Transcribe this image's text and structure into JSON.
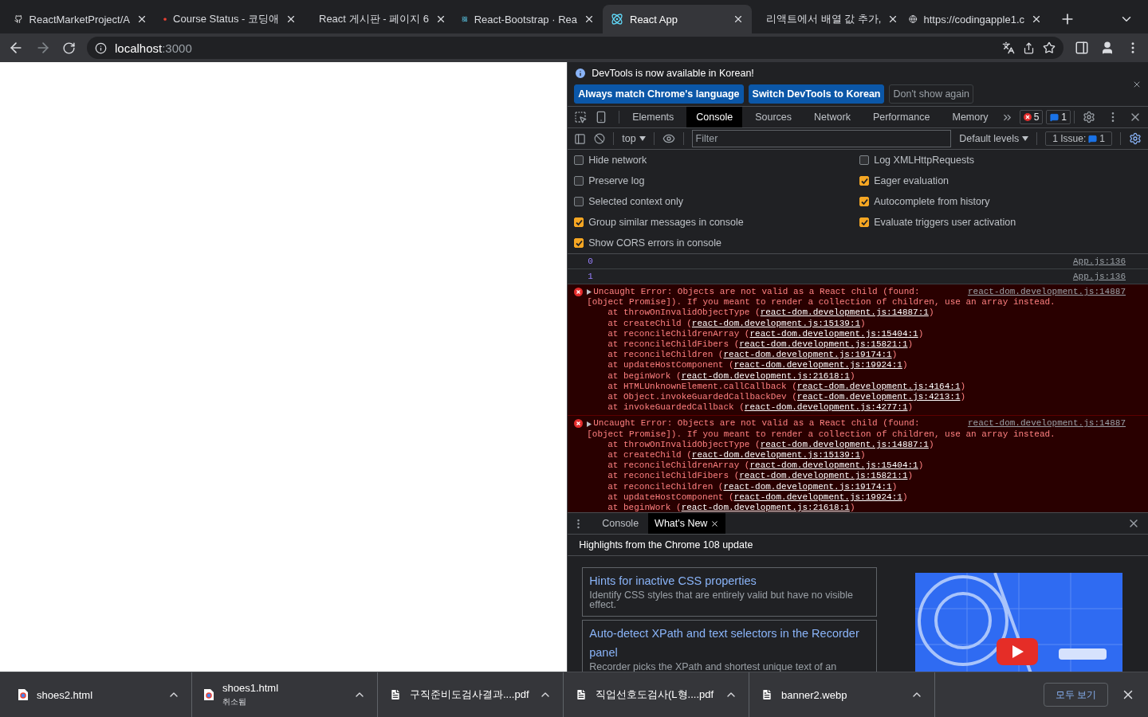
{
  "browser_tabs": [
    {
      "title": "ReactMarketProject/A",
      "kind": "logo",
      "selected": false
    },
    {
      "title": "Course Status - 코딩애",
      "kind": "apple",
      "selected": false
    },
    {
      "title": "React 게시판 - 페이지 6",
      "kind": "apple",
      "selected": false
    },
    {
      "title": "React-Bootstrap · Rea",
      "kind": "atom",
      "selected": false
    },
    {
      "title": "React App",
      "kind": "atom",
      "selected": true
    },
    {
      "title": "리액트에서 배열 값 추가,",
      "kind": "logo",
      "selected": false
    },
    {
      "title": "https://codingapple1.c",
      "kind": "globe",
      "selected": false
    }
  ],
  "address_bar": {
    "host": "localhost",
    "port": ":3000"
  },
  "infobar": {
    "message": "DevTools is now available in Korean!",
    "buttons": [
      {
        "label": "Always match Chrome's language",
        "kind": "primary"
      },
      {
        "label": "Switch DevTools to Korean",
        "kind": "primary"
      },
      {
        "label": "Don't show again",
        "kind": "secondary"
      }
    ]
  },
  "devtools_tabs": [
    {
      "label": "Elements",
      "selected": false
    },
    {
      "label": "Console",
      "selected": true
    },
    {
      "label": "Sources",
      "selected": false
    },
    {
      "label": "Network",
      "selected": false
    },
    {
      "label": "Performance",
      "selected": false
    },
    {
      "label": "Memory",
      "selected": false
    }
  ],
  "counters": {
    "errors": "5",
    "messages": "1"
  },
  "console_toolbar": {
    "context": "top",
    "filter_placeholder": "Filter",
    "levels": "Default levels",
    "issues_label": "1 Issue:",
    "issues_count": "1"
  },
  "settings": [
    {
      "label": "Hide network",
      "checked": false
    },
    {
      "label": "Log XMLHttpRequests",
      "checked": false
    },
    {
      "label": "Preserve log",
      "checked": false
    },
    {
      "label": "Eager evaluation",
      "checked": true
    },
    {
      "label": "Selected context only",
      "checked": false
    },
    {
      "label": "Autocomplete from history",
      "checked": true
    },
    {
      "label": "Group similar messages in console",
      "checked": true
    },
    {
      "label": "Evaluate triggers user activation",
      "checked": true
    },
    {
      "label": "Show CORS errors in console",
      "checked": true
    }
  ],
  "messages": [
    {
      "kind": "log",
      "text": "0",
      "source": "App.js:136"
    },
    {
      "kind": "log",
      "text": "1",
      "source": "App.js:136"
    },
    {
      "kind": "error",
      "lines": [
        "Uncaught Error: Objects are not valid as a React child (found:",
        "[object Promise]). If you meant to render a collection of children, use an array instead."
      ],
      "source": "react-dom.development.js:14887",
      "stack": [
        {
          "fn": "at throwOnInvalidObjectType (",
          "link": "react-dom.development.js:14887:1"
        },
        {
          "fn": "at createChild (",
          "link": "react-dom.development.js:15139:1"
        },
        {
          "fn": "at reconcileChildrenArray (",
          "link": "react-dom.development.js:15404:1"
        },
        {
          "fn": "at reconcileChildFibers (",
          "link": "react-dom.development.js:15821:1"
        },
        {
          "fn": "at reconcileChildren (",
          "link": "react-dom.development.js:19174:1"
        },
        {
          "fn": "at updateHostComponent (",
          "link": "react-dom.development.js:19924:1"
        },
        {
          "fn": "at beginWork (",
          "link": "react-dom.development.js:21618:1"
        },
        {
          "fn": "at HTMLUnknownElement.callCallback (",
          "link": "react-dom.development.js:4164:1"
        },
        {
          "fn": "at Object.invokeGuardedCallbackDev (",
          "link": "react-dom.development.js:4213:1"
        },
        {
          "fn": "at invokeGuardedCallback (",
          "link": "react-dom.development.js:4277:1"
        }
      ]
    },
    {
      "kind": "error",
      "lines": [
        "Uncaught Error: Objects are not valid as a React child (found:",
        "[object Promise]). If you meant to render a collection of children, use an array instead."
      ],
      "source": "react-dom.development.js:14887",
      "stack": [
        {
          "fn": "at throwOnInvalidObjectType (",
          "link": "react-dom.development.js:14887:1"
        },
        {
          "fn": "at createChild (",
          "link": "react-dom.development.js:15139:1"
        },
        {
          "fn": "at reconcileChildrenArray (",
          "link": "react-dom.development.js:15404:1"
        },
        {
          "fn": "at reconcileChildFibers (",
          "link": "react-dom.development.js:15821:1"
        },
        {
          "fn": "at reconcileChildren (",
          "link": "react-dom.development.js:19174:1"
        },
        {
          "fn": "at updateHostComponent (",
          "link": "react-dom.development.js:19924:1"
        },
        {
          "fn": "at beginWork (",
          "link": "react-dom.development.js:21618:1"
        }
      ]
    }
  ],
  "stack_close": ")",
  "drawer_tabs": [
    {
      "label": "Console",
      "selected": false,
      "closable": false
    },
    {
      "label": "What's New",
      "selected": true,
      "closable": true
    }
  ],
  "whats_new": {
    "heading": "Highlights from the Chrome 108 update",
    "cards": [
      {
        "title": "Hints for inactive CSS properties",
        "text": "Identify CSS styles that are entirely valid but have no visible effect."
      },
      {
        "title": "Auto-detect XPath and text selectors in the Recorder panel",
        "text": "Recorder picks the XPath and shortest unique text of an"
      }
    ]
  },
  "downloads": [
    {
      "name": "shoes2.html",
      "kind": "web"
    },
    {
      "name": "shoes1.html",
      "status": "취소됨",
      "kind": "web"
    },
    {
      "name": "구직준비도검사결과....pdf",
      "kind": "doc"
    },
    {
      "name": "직업선호도검사(L형....pdf",
      "kind": "doc"
    },
    {
      "name": "banner2.webp",
      "kind": "doc"
    }
  ],
  "show_all": "모두 보기"
}
